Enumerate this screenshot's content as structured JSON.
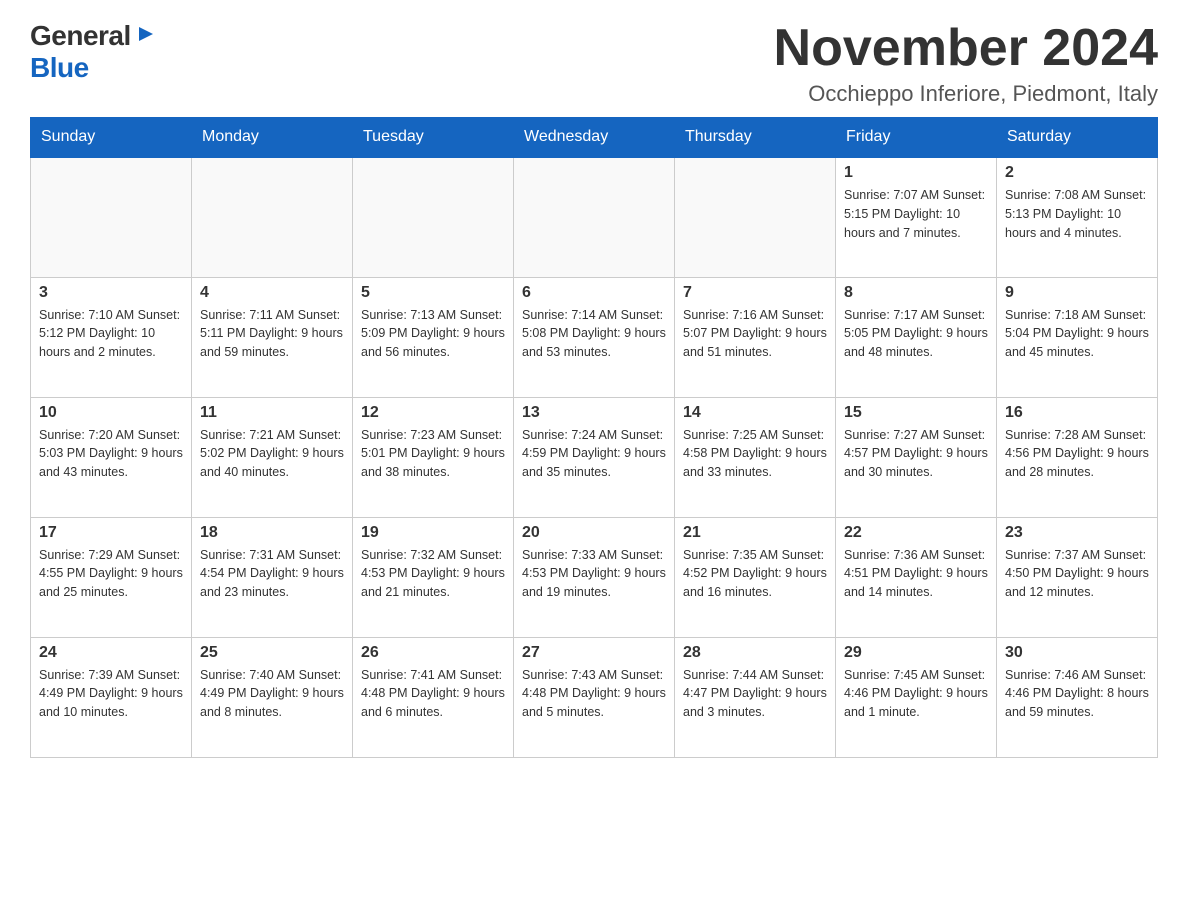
{
  "header": {
    "logo_general": "General",
    "logo_blue": "Blue",
    "month_title": "November 2024",
    "location": "Occhieppo Inferiore, Piedmont, Italy"
  },
  "weekdays": [
    "Sunday",
    "Monday",
    "Tuesday",
    "Wednesday",
    "Thursday",
    "Friday",
    "Saturday"
  ],
  "weeks": [
    [
      {
        "day": "",
        "info": ""
      },
      {
        "day": "",
        "info": ""
      },
      {
        "day": "",
        "info": ""
      },
      {
        "day": "",
        "info": ""
      },
      {
        "day": "",
        "info": ""
      },
      {
        "day": "1",
        "info": "Sunrise: 7:07 AM\nSunset: 5:15 PM\nDaylight: 10 hours and 7 minutes."
      },
      {
        "day": "2",
        "info": "Sunrise: 7:08 AM\nSunset: 5:13 PM\nDaylight: 10 hours and 4 minutes."
      }
    ],
    [
      {
        "day": "3",
        "info": "Sunrise: 7:10 AM\nSunset: 5:12 PM\nDaylight: 10 hours and 2 minutes."
      },
      {
        "day": "4",
        "info": "Sunrise: 7:11 AM\nSunset: 5:11 PM\nDaylight: 9 hours and 59 minutes."
      },
      {
        "day": "5",
        "info": "Sunrise: 7:13 AM\nSunset: 5:09 PM\nDaylight: 9 hours and 56 minutes."
      },
      {
        "day": "6",
        "info": "Sunrise: 7:14 AM\nSunset: 5:08 PM\nDaylight: 9 hours and 53 minutes."
      },
      {
        "day": "7",
        "info": "Sunrise: 7:16 AM\nSunset: 5:07 PM\nDaylight: 9 hours and 51 minutes."
      },
      {
        "day": "8",
        "info": "Sunrise: 7:17 AM\nSunset: 5:05 PM\nDaylight: 9 hours and 48 minutes."
      },
      {
        "day": "9",
        "info": "Sunrise: 7:18 AM\nSunset: 5:04 PM\nDaylight: 9 hours and 45 minutes."
      }
    ],
    [
      {
        "day": "10",
        "info": "Sunrise: 7:20 AM\nSunset: 5:03 PM\nDaylight: 9 hours and 43 minutes."
      },
      {
        "day": "11",
        "info": "Sunrise: 7:21 AM\nSunset: 5:02 PM\nDaylight: 9 hours and 40 minutes."
      },
      {
        "day": "12",
        "info": "Sunrise: 7:23 AM\nSunset: 5:01 PM\nDaylight: 9 hours and 38 minutes."
      },
      {
        "day": "13",
        "info": "Sunrise: 7:24 AM\nSunset: 4:59 PM\nDaylight: 9 hours and 35 minutes."
      },
      {
        "day": "14",
        "info": "Sunrise: 7:25 AM\nSunset: 4:58 PM\nDaylight: 9 hours and 33 minutes."
      },
      {
        "day": "15",
        "info": "Sunrise: 7:27 AM\nSunset: 4:57 PM\nDaylight: 9 hours and 30 minutes."
      },
      {
        "day": "16",
        "info": "Sunrise: 7:28 AM\nSunset: 4:56 PM\nDaylight: 9 hours and 28 minutes."
      }
    ],
    [
      {
        "day": "17",
        "info": "Sunrise: 7:29 AM\nSunset: 4:55 PM\nDaylight: 9 hours and 25 minutes."
      },
      {
        "day": "18",
        "info": "Sunrise: 7:31 AM\nSunset: 4:54 PM\nDaylight: 9 hours and 23 minutes."
      },
      {
        "day": "19",
        "info": "Sunrise: 7:32 AM\nSunset: 4:53 PM\nDaylight: 9 hours and 21 minutes."
      },
      {
        "day": "20",
        "info": "Sunrise: 7:33 AM\nSunset: 4:53 PM\nDaylight: 9 hours and 19 minutes."
      },
      {
        "day": "21",
        "info": "Sunrise: 7:35 AM\nSunset: 4:52 PM\nDaylight: 9 hours and 16 minutes."
      },
      {
        "day": "22",
        "info": "Sunrise: 7:36 AM\nSunset: 4:51 PM\nDaylight: 9 hours and 14 minutes."
      },
      {
        "day": "23",
        "info": "Sunrise: 7:37 AM\nSunset: 4:50 PM\nDaylight: 9 hours and 12 minutes."
      }
    ],
    [
      {
        "day": "24",
        "info": "Sunrise: 7:39 AM\nSunset: 4:49 PM\nDaylight: 9 hours and 10 minutes."
      },
      {
        "day": "25",
        "info": "Sunrise: 7:40 AM\nSunset: 4:49 PM\nDaylight: 9 hours and 8 minutes."
      },
      {
        "day": "26",
        "info": "Sunrise: 7:41 AM\nSunset: 4:48 PM\nDaylight: 9 hours and 6 minutes."
      },
      {
        "day": "27",
        "info": "Sunrise: 7:43 AM\nSunset: 4:48 PM\nDaylight: 9 hours and 5 minutes."
      },
      {
        "day": "28",
        "info": "Sunrise: 7:44 AM\nSunset: 4:47 PM\nDaylight: 9 hours and 3 minutes."
      },
      {
        "day": "29",
        "info": "Sunrise: 7:45 AM\nSunset: 4:46 PM\nDaylight: 9 hours and 1 minute."
      },
      {
        "day": "30",
        "info": "Sunrise: 7:46 AM\nSunset: 4:46 PM\nDaylight: 8 hours and 59 minutes."
      }
    ]
  ]
}
